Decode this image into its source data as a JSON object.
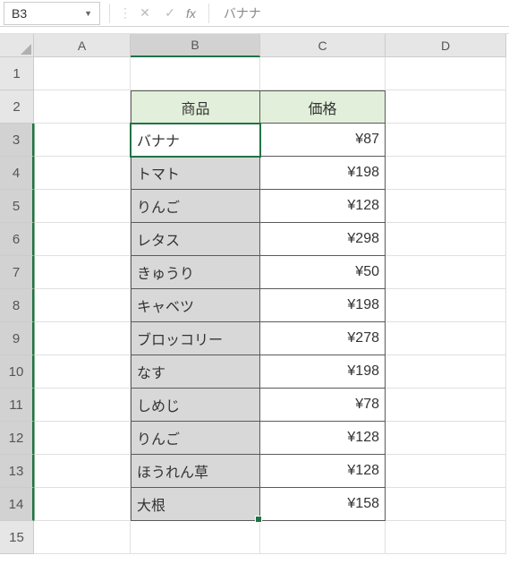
{
  "nameBox": "B3",
  "formulaValue": "バナナ",
  "columns": [
    "A",
    "B",
    "C",
    "D"
  ],
  "rows": [
    "1",
    "2",
    "3",
    "4",
    "5",
    "6",
    "7",
    "8",
    "9",
    "10",
    "11",
    "12",
    "13",
    "14",
    "15"
  ],
  "headers": {
    "product": "商品",
    "price": "価格"
  },
  "chart_data": {
    "type": "table",
    "title": "",
    "columns": [
      "商品",
      "価格"
    ],
    "rows": [
      {
        "product": "バナナ",
        "price": "¥87"
      },
      {
        "product": "トマト",
        "price": "¥198"
      },
      {
        "product": "りんご",
        "price": "¥128"
      },
      {
        "product": "レタス",
        "price": "¥298"
      },
      {
        "product": "きゅうり",
        "price": "¥50"
      },
      {
        "product": "キャベツ",
        "price": "¥198"
      },
      {
        "product": "ブロッコリー",
        "price": "¥278"
      },
      {
        "product": "なす",
        "price": "¥198"
      },
      {
        "product": "しめじ",
        "price": "¥78"
      },
      {
        "product": "りんご",
        "price": "¥128"
      },
      {
        "product": "ほうれん草",
        "price": "¥128"
      },
      {
        "product": "大根",
        "price": "¥158"
      }
    ]
  }
}
